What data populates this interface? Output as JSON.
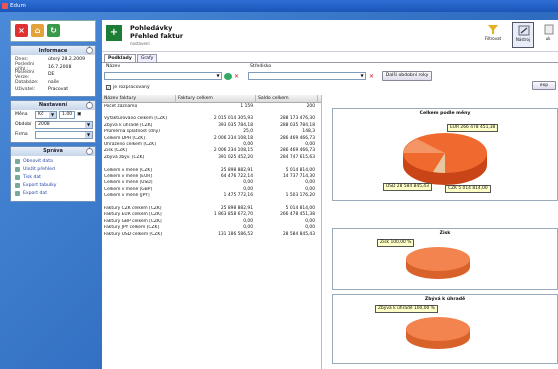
{
  "window": {
    "title": "Edum"
  },
  "left": {
    "info": {
      "title": "Informace",
      "rows": [
        {
          "k": "Dnes:",
          "v": "úterý 28.2.2009"
        },
        {
          "k": "Poslední přihl.:",
          "v": "16.7.2008"
        },
        {
          "k": "Poslední Verze:",
          "v": "DE"
        },
        {
          "k": "Databáze:",
          "v": "naše"
        },
        {
          "k": "Uživatel:",
          "v": "Pracovat"
        }
      ]
    },
    "settings": {
      "title": "Nastavení",
      "mena_label": "Měna",
      "mena_value": "Kč",
      "mena_rate": "1.00",
      "obdobi_label": "Období",
      "obdobi_value": "2008",
      "firma_label": "Firma",
      "firma_value": ""
    },
    "tools": {
      "title": "Správa",
      "items": [
        "Obnovit data",
        "Uložit přehled",
        "Tisk dat",
        "Export tabulky",
        "Export dat"
      ]
    }
  },
  "main": {
    "title": "Pohledávky",
    "subtitle": "Přehled faktur",
    "note": "nastavení",
    "ribbon": [
      {
        "label": "Filtrovat"
      },
      {
        "label": "Nástroj"
      },
      {
        "label": "uk"
      }
    ],
    "tabs": [
      "Podklady",
      "Grafy"
    ],
    "filters": {
      "field1_label": "Název",
      "field1_value": "",
      "field2_label": "Středisko",
      "field2_value": "",
      "apply_button": "Další obdobní roky",
      "checkbox_label": "je rozpracovaný",
      "side_button": "exp"
    },
    "table": {
      "headers": [
        "Název faktury",
        "Faktury celkem",
        "Saldo celkem"
      ],
      "rows": [
        [
          "Počet záznamů",
          "1 159",
          "200"
        ],
        [
          "",
          "",
          ""
        ],
        [
          "Vyfakturováno celkem [CZK]",
          "2 015 014 305,93",
          "288 173 476,30"
        ],
        [
          "Zbývá k úhradě [CZK]",
          "393 035 784,18",
          "288 035 784,18"
        ],
        [
          "Průměrná splatnost (dny)",
          "25,0",
          "148,3"
        ],
        [
          "Celkem DPH [CZK]",
          "2 006 234 108,18",
          "286 469 466,73"
        ],
        [
          "Uhrazeno celkem [CZK]",
          "0,00",
          "0,00"
        ],
        [
          "Zisk [CZK]",
          "2 006 234 108,15",
          "286 469 466,73"
        ],
        [
          "Zbývá zbýv. [CZK]",
          "391 025 452,20",
          "284 747 615,63"
        ],
        [
          "",
          "",
          ""
        ],
        [
          "Celkem v měně [CZK]",
          "25 898 882,91",
          "5 014 814,00"
        ],
        [
          "Celkem v měně [EUR]",
          "64 476 722,14",
          "14 737 714,30"
        ],
        [
          "Celkem v měně [USD]",
          "0,00",
          "0,00"
        ],
        [
          "Celkem v měně [GBP]",
          "0,00",
          "0,00"
        ],
        [
          "Celkem v měně [JPY]",
          "1 475 772,16",
          "1 503 176,20"
        ],
        [
          "",
          "",
          ""
        ],
        [
          "Faktury CZK celkem [CZK]",
          "25 898 882,91",
          "5 014 814,00"
        ],
        [
          "Faktury EUR celkem [CZK]",
          "1 863 858 672,70",
          "266 478 451,38"
        ],
        [
          "Faktury GBP celkem [CZK]",
          "0,00",
          "0,00"
        ],
        [
          "Faktury JPY celkem [CZK]",
          "0,00",
          "0,00"
        ],
        [
          "Faktury USD celkem [CZK]",
          "131 186 586,52",
          "28 584 845,43"
        ]
      ]
    }
  },
  "charts": [
    {
      "title": "Celkem podle měny",
      "type": "pie",
      "tags": [
        "EUR 266 478 451,38",
        "USD 28 584 845,43",
        "CZK 5 014 814,00"
      ]
    },
    {
      "title": "Zisk",
      "type": "pie",
      "tags": [
        "Zisk 100,00 %"
      ]
    },
    {
      "title": "Zbývá k úhradě",
      "type": "pie",
      "tags": [
        "Zbývá k úhradě 100,00 %"
      ]
    }
  ],
  "chart_data": [
    {
      "type": "pie",
      "title": "Celkem podle měny",
      "slices": [
        {
          "name": "EUR",
          "value": 266478451.38
        },
        {
          "name": "USD",
          "value": 28584845.43
        },
        {
          "name": "CZK",
          "value": 5014814.0
        }
      ]
    },
    {
      "type": "pie",
      "title": "Zisk",
      "slices": [
        {
          "name": "Zisk",
          "value": 100
        }
      ]
    },
    {
      "type": "pie",
      "title": "Zbývá k úhradě",
      "slices": [
        {
          "name": "Zbývá k úhradě",
          "value": 100
        }
      ]
    }
  ]
}
